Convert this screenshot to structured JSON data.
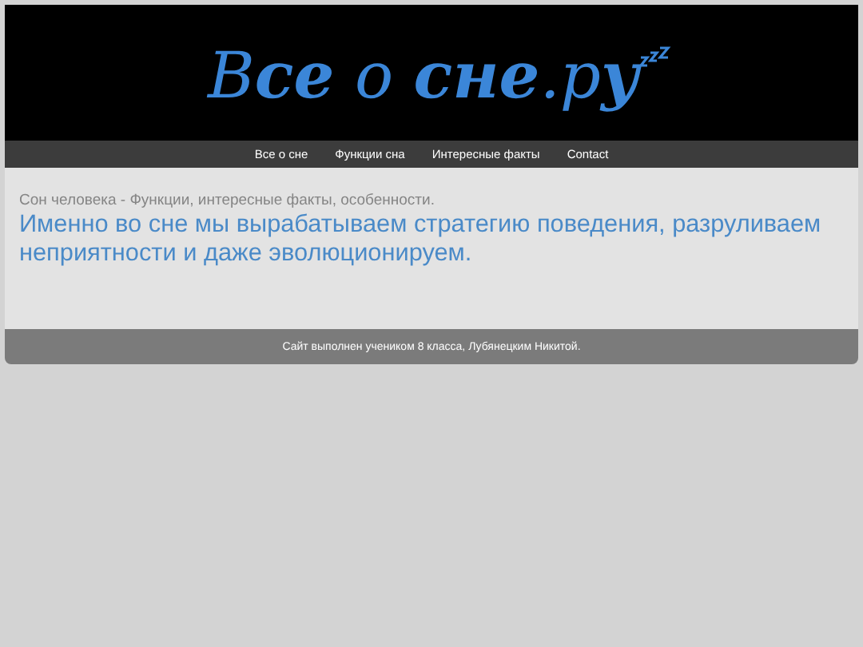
{
  "logo": "В**се** о **сне**.р**у**",
  "nav": [
    {
      "label": "Все о сне"
    },
    {
      "label": "Функции сна"
    },
    {
      "label": "Интересные факты"
    },
    {
      "label": "Contact"
    }
  ],
  "content": {
    "subtitle": "Сон человека - Функции, интересные факты, особенности.",
    "lead": "Именно во сне мы вырабатываем стратегию поведения, разруливаем неприятности и даже эволюционируем."
  },
  "footer": "Сайт выполнен учеником 8 класса, Лубянецким Никитой."
}
